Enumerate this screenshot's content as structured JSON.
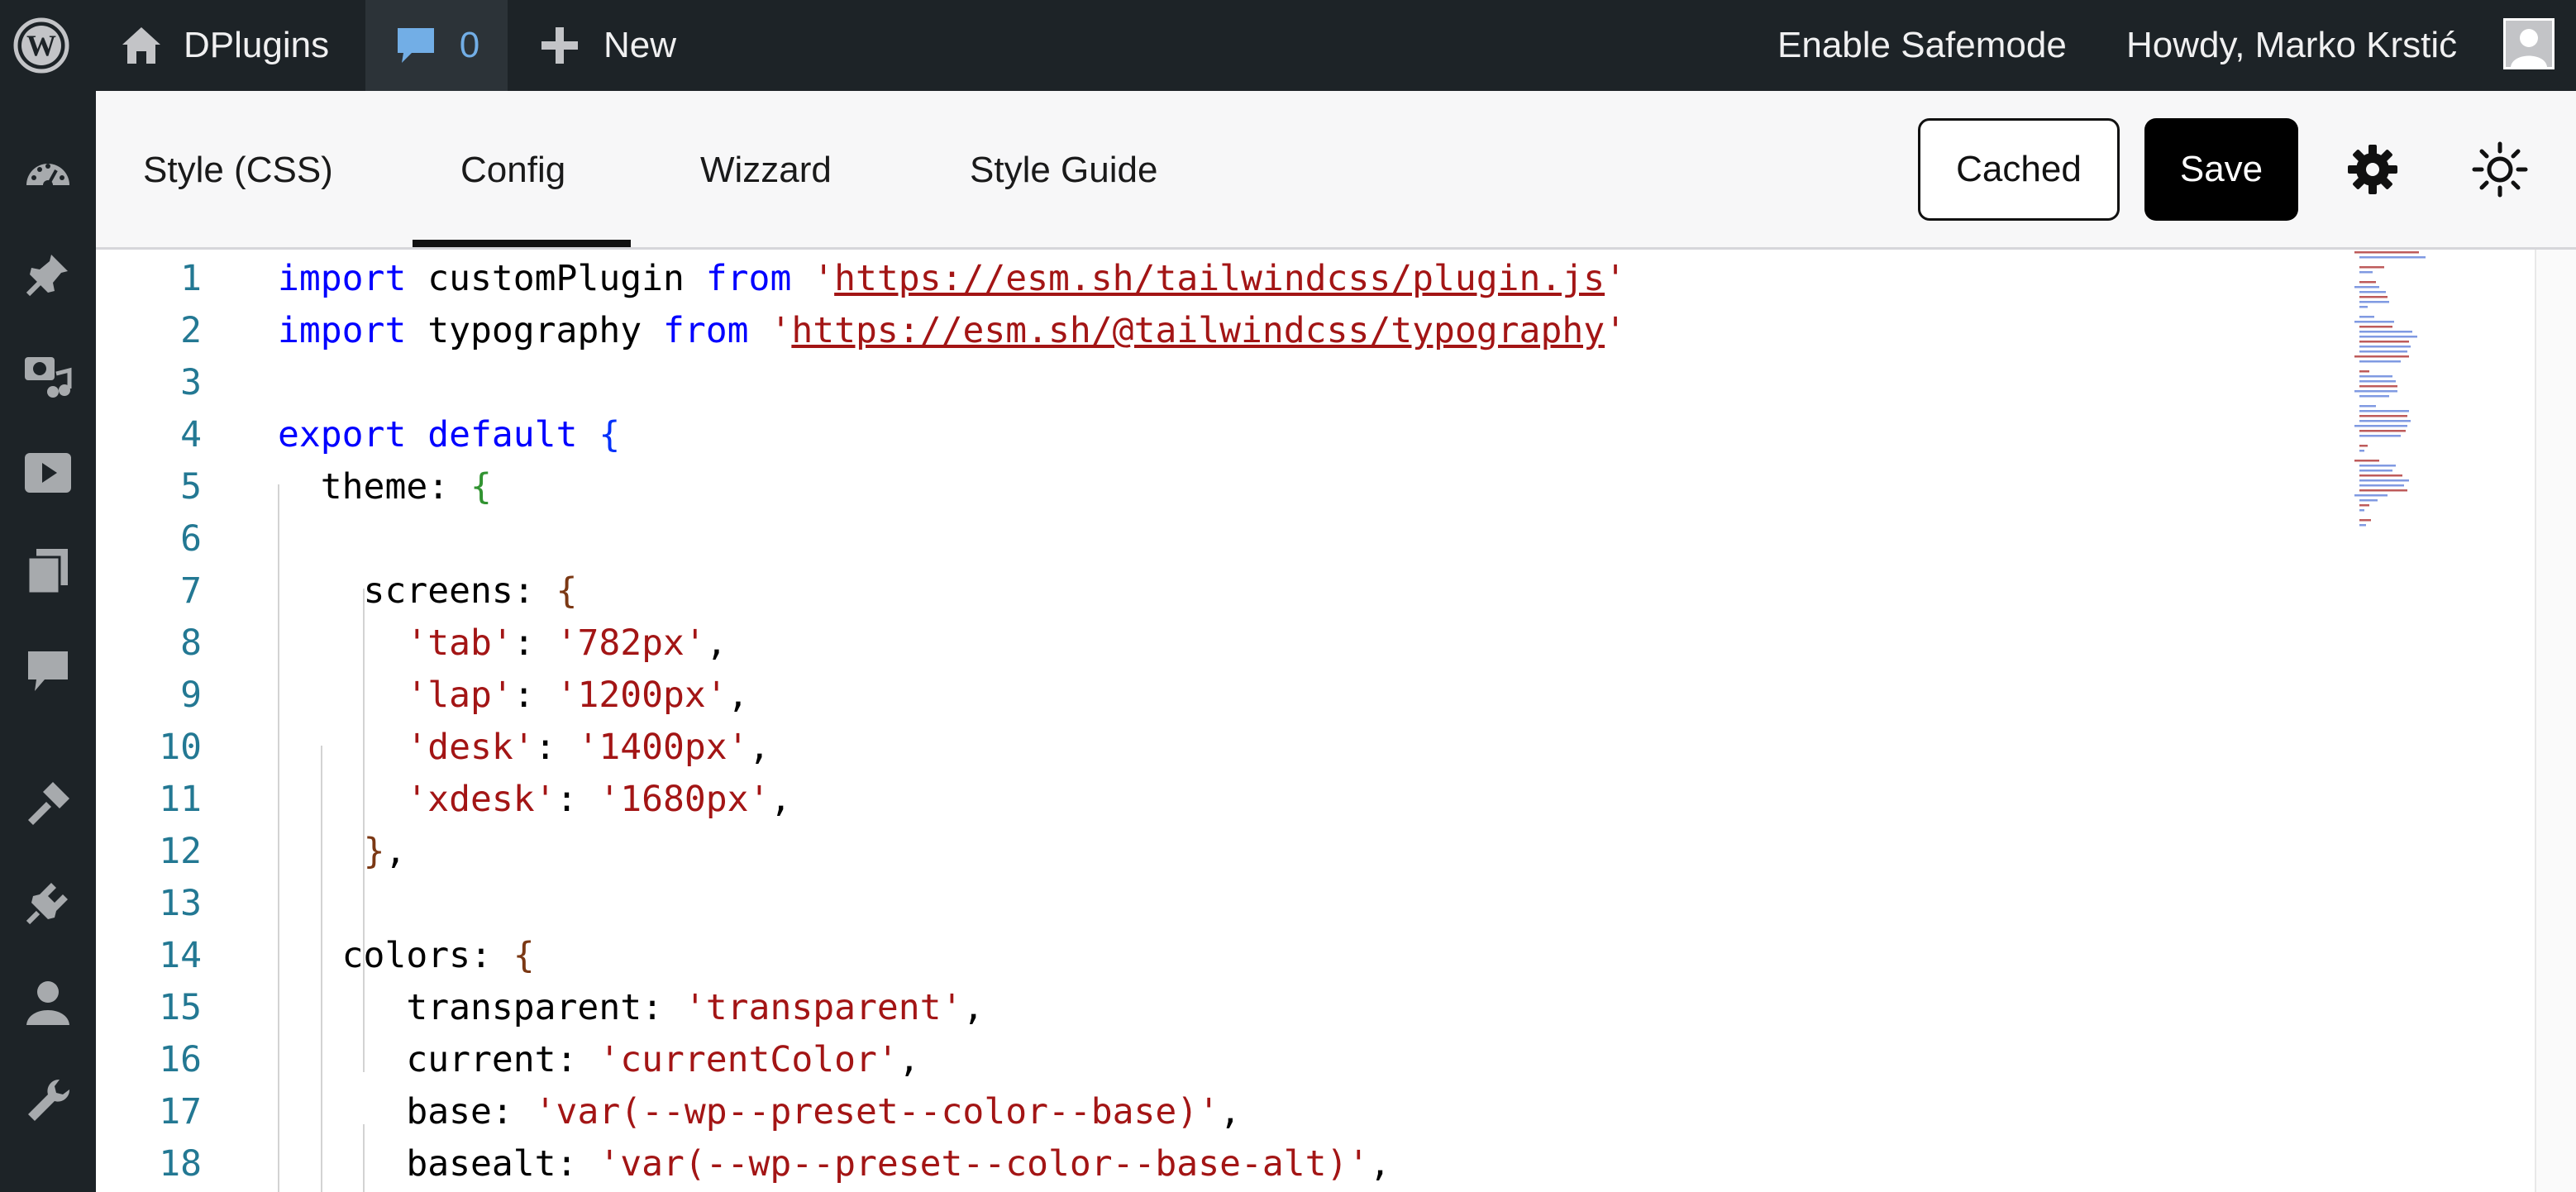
{
  "adminbar": {
    "site_name": "DPlugins",
    "comments_count": "0",
    "new_label": "New",
    "safemode_label": "Enable Safemode",
    "howdy_label": "Howdy, Marko Krstić",
    "icons": [
      "wordpress-logo-icon",
      "home-icon",
      "comment-bubble-icon",
      "plus-icon",
      "avatar-icon"
    ]
  },
  "sidebar": {
    "items": [
      {
        "name": "dashboard",
        "icon": "dashboard-gauge-icon"
      },
      {
        "name": "posts",
        "icon": "pushpin-icon"
      },
      {
        "name": "media",
        "icon": "media-camera-music-icon"
      },
      {
        "name": "video",
        "icon": "video-play-icon"
      },
      {
        "name": "pages",
        "icon": "pages-icon"
      },
      {
        "name": "comments",
        "icon": "comment-icon"
      },
      {
        "name": "appearance",
        "icon": "paintbrush-icon"
      },
      {
        "name": "plugins",
        "icon": "plugin-icon"
      },
      {
        "name": "users",
        "icon": "user-icon"
      },
      {
        "name": "tools",
        "icon": "wrench-icon"
      }
    ]
  },
  "toolbar": {
    "tabs": [
      "Style (CSS)",
      "Config",
      "Wizzard",
      "Style Guide"
    ],
    "active_tab": "Config",
    "cached_label": "Cached",
    "save_label": "Save",
    "icons": [
      "gear-icon",
      "theme-sun-icon"
    ]
  },
  "colors": {
    "adminbar_bg": "#1d2327",
    "keyword": "#0000ff",
    "string": "#a31515",
    "line_number": "#237893",
    "bracket_level1": "#0431fa",
    "bracket_level2": "#319331",
    "bracket_level3": "#7b3814"
  },
  "editor": {
    "lines": [
      {
        "n": "1",
        "tokens": [
          {
            "t": "kw",
            "v": "import"
          },
          {
            "t": "plain",
            "v": " customPlugin "
          },
          {
            "t": "kw",
            "v": "from"
          },
          {
            "t": "plain",
            "v": " "
          },
          {
            "t": "str",
            "v": "'"
          },
          {
            "t": "url",
            "v": "https://esm.sh/tailwindcss/plugin.js"
          },
          {
            "t": "str",
            "v": "'"
          }
        ]
      },
      {
        "n": "2",
        "tokens": [
          {
            "t": "kw",
            "v": "import"
          },
          {
            "t": "plain",
            "v": " typography "
          },
          {
            "t": "kw",
            "v": "from"
          },
          {
            "t": "plain",
            "v": " "
          },
          {
            "t": "str",
            "v": "'"
          },
          {
            "t": "url",
            "v": "https://esm.sh/@tailwindcss/typography"
          },
          {
            "t": "str",
            "v": "'"
          }
        ]
      },
      {
        "n": "3",
        "tokens": []
      },
      {
        "n": "4",
        "tokens": [
          {
            "t": "kw",
            "v": "export"
          },
          {
            "t": "plain",
            "v": " "
          },
          {
            "t": "kw",
            "v": "default"
          },
          {
            "t": "plain",
            "v": " "
          },
          {
            "t": "b1",
            "v": "{"
          }
        ]
      },
      {
        "n": "5",
        "tokens": [
          {
            "t": "plain",
            "v": "  theme: "
          },
          {
            "t": "b2",
            "v": "{"
          }
        ]
      },
      {
        "n": "6",
        "tokens": []
      },
      {
        "n": "7",
        "tokens": [
          {
            "t": "plain",
            "v": "    screens: "
          },
          {
            "t": "b3",
            "v": "{"
          }
        ]
      },
      {
        "n": "8",
        "tokens": [
          {
            "t": "plain",
            "v": "      "
          },
          {
            "t": "str",
            "v": "'tab'"
          },
          {
            "t": "plain",
            "v": ": "
          },
          {
            "t": "str",
            "v": "'782px'"
          },
          {
            "t": "plain",
            "v": ","
          }
        ]
      },
      {
        "n": "9",
        "tokens": [
          {
            "t": "plain",
            "v": "      "
          },
          {
            "t": "str",
            "v": "'lap'"
          },
          {
            "t": "plain",
            "v": ": "
          },
          {
            "t": "str",
            "v": "'1200px'"
          },
          {
            "t": "plain",
            "v": ","
          }
        ]
      },
      {
        "n": "10",
        "tokens": [
          {
            "t": "plain",
            "v": "      "
          },
          {
            "t": "str",
            "v": "'desk'"
          },
          {
            "t": "plain",
            "v": ": "
          },
          {
            "t": "str",
            "v": "'1400px'"
          },
          {
            "t": "plain",
            "v": ","
          }
        ]
      },
      {
        "n": "11",
        "tokens": [
          {
            "t": "plain",
            "v": "      "
          },
          {
            "t": "str",
            "v": "'xdesk'"
          },
          {
            "t": "plain",
            "v": ": "
          },
          {
            "t": "str",
            "v": "'1680px'"
          },
          {
            "t": "plain",
            "v": ","
          }
        ]
      },
      {
        "n": "12",
        "tokens": [
          {
            "t": "plain",
            "v": "    "
          },
          {
            "t": "b3",
            "v": "}"
          },
          {
            "t": "plain",
            "v": ","
          }
        ]
      },
      {
        "n": "13",
        "tokens": []
      },
      {
        "n": "14",
        "tokens": [
          {
            "t": "plain",
            "v": "   colors: "
          },
          {
            "t": "b3",
            "v": "{"
          }
        ]
      },
      {
        "n": "15",
        "tokens": [
          {
            "t": "plain",
            "v": "      transparent: "
          },
          {
            "t": "str",
            "v": "'transparent'"
          },
          {
            "t": "plain",
            "v": ","
          }
        ]
      },
      {
        "n": "16",
        "tokens": [
          {
            "t": "plain",
            "v": "      current: "
          },
          {
            "t": "str",
            "v": "'currentColor'"
          },
          {
            "t": "plain",
            "v": ","
          }
        ]
      },
      {
        "n": "17",
        "tokens": [
          {
            "t": "plain",
            "v": "      base: "
          },
          {
            "t": "str",
            "v": "'var(--wp--preset--color--base)'"
          },
          {
            "t": "plain",
            "v": ","
          }
        ]
      },
      {
        "n": "18",
        "tokens": [
          {
            "t": "plain",
            "v": "      basealt: "
          },
          {
            "t": "str",
            "v": "'var(--wp--preset--color--base-alt)'"
          },
          {
            "t": "plain",
            "v": ","
          }
        ]
      }
    ]
  }
}
